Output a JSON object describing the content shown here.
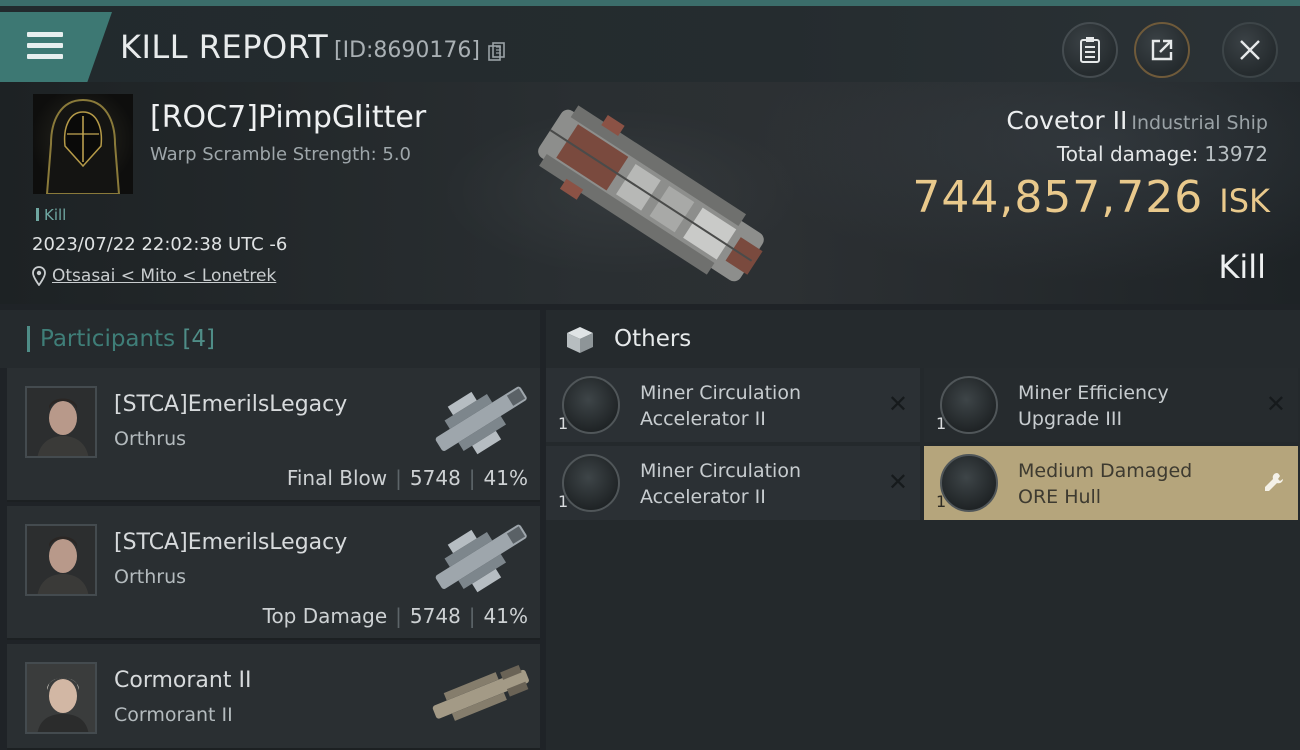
{
  "header": {
    "title": "KILL REPORT",
    "report_id": "[ID:8690176]"
  },
  "victim": {
    "name": "[ROC7]PimpGlitter",
    "subtitle": "Warp Scramble Strength: 5.0",
    "tag": "Kill",
    "datetime": "2023/07/22 22:02:38 UTC -6",
    "location": "Otsasai < Mito < Lonetrek",
    "ship_name": "Covetor II",
    "ship_class": "Industrial Ship",
    "damage_label": "Total damage:",
    "damage_value": "13972",
    "isk_value": "744,857,726",
    "isk_unit": "ISK",
    "result": "Kill"
  },
  "participants": {
    "title": "Participants",
    "count": "[4]",
    "rows": [
      {
        "name": "[STCA]EmerilsLegacy",
        "ship": "Orthrus",
        "role": "Final Blow",
        "damage": "5748",
        "percent": "41%"
      },
      {
        "name": "[STCA]EmerilsLegacy",
        "ship": "Orthrus",
        "role": "Top Damage",
        "damage": "5748",
        "percent": "41%"
      },
      {
        "name": "Cormorant II",
        "ship": "Cormorant II"
      }
    ]
  },
  "others": {
    "title": "Others",
    "items": [
      {
        "label": "Miner Circulation\nAccelerator II",
        "qty": "1",
        "tier": "II",
        "status": "destroyed"
      },
      {
        "label": "Miner Efficiency\nUpgrade III",
        "qty": "1",
        "tier": "III",
        "status": "destroyed"
      },
      {
        "label": "Miner Circulation\nAccelerator II",
        "qty": "1",
        "tier": "II",
        "status": "destroyed"
      },
      {
        "label": "Medium Damaged\nORE Hull",
        "qty": "1",
        "status": "dropped"
      }
    ]
  },
  "icons": {
    "menu": "hamburger-icon",
    "copy": "copy-icon",
    "notes": "clipboard-icon",
    "share": "share-icon",
    "close": "close-icon",
    "location": "location-pin-icon",
    "others": "box-icon",
    "destroyed": "x-icon",
    "dropped": "wrench-icon"
  },
  "colors": {
    "accent_teal": "#3d7873",
    "isk_gold": "#e9c98c",
    "dropped_item_bg": "#b5a57c"
  }
}
